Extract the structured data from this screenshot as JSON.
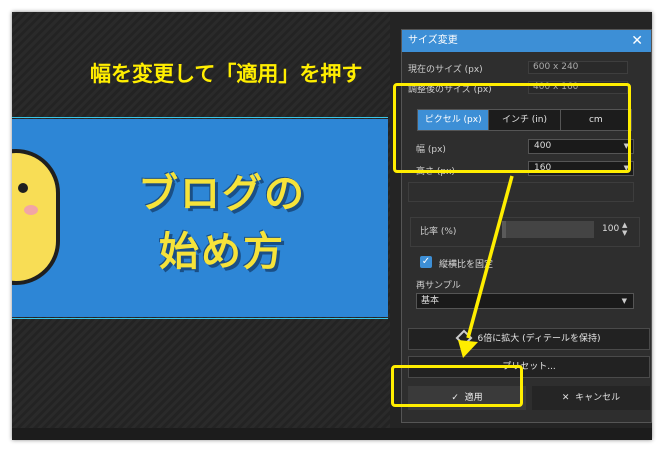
{
  "annotation": {
    "instruction": "幅を変更して「適用」を押す",
    "highlight_color": "#ffee00"
  },
  "thumbnail": {
    "line1": "ブログの",
    "line2": "始め方",
    "bg_color": "#2d86d6",
    "text_color": "#f6e33a"
  },
  "dialog": {
    "title": "サイズ変更",
    "current_size_label": "現在のサイズ (px)",
    "current_size_value": "600 x 240",
    "new_size_label": "調整後のサイズ (px)",
    "new_size_value": "400 x 160",
    "unit_tabs": [
      "ピクセル (px)",
      "インチ (in)",
      "cm"
    ],
    "width_label": "幅 (px)",
    "width_value": "400",
    "height_label": "高さ (px)",
    "height_value": "160",
    "ratio_label": "比率 (%)",
    "ratio_value": "100",
    "lock_label": "縦横比を固定",
    "resample_label": "再サンプル",
    "resample_value": "基本",
    "enlarge_button": "6倍に拡大 (ディテールを保持)",
    "preset_button": "プリセット...",
    "apply_button": "適用",
    "cancel_button": "キャンセル",
    "accent_color": "#3d8fd6"
  }
}
